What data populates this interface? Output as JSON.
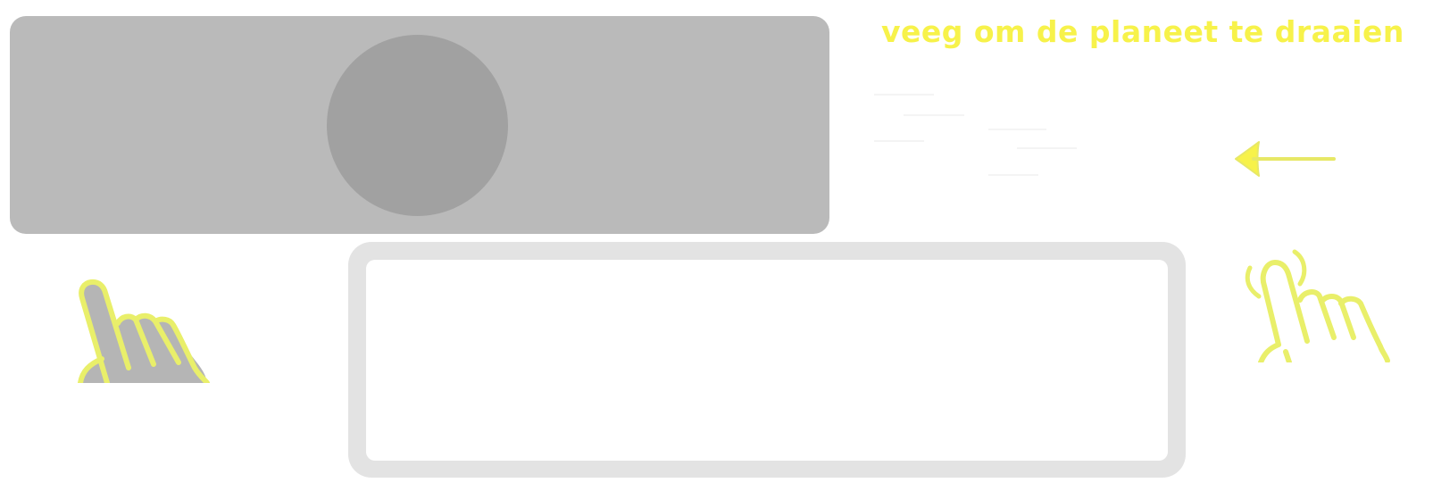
{
  "instruction": {
    "text": "veeg om de planeet te draaien"
  },
  "colors": {
    "accent": "#f7f24a",
    "panel_bg": "#bababa",
    "planet": "#a1a1a1",
    "frame": "#e3e3e3"
  },
  "icons": {
    "left_hand": "pointing-hand-icon",
    "right_hand": "swipe-hand-icon",
    "arrow": "arrow-left-icon"
  }
}
